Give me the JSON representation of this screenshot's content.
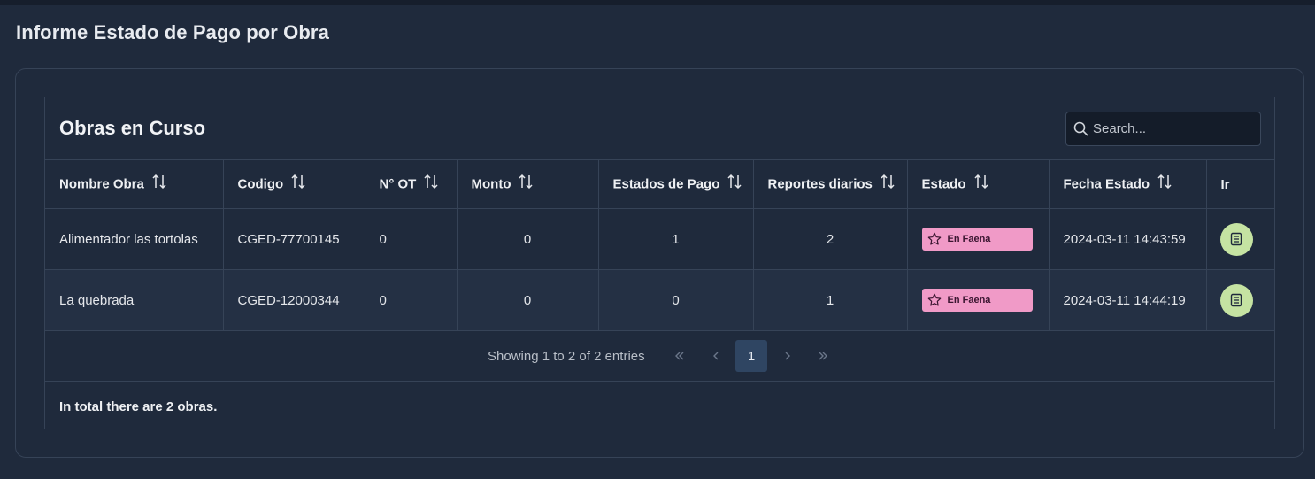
{
  "page": {
    "title": "Informe Estado de Pago por Obra"
  },
  "card": {
    "title": "Obras en Curso",
    "search_placeholder": "Search..."
  },
  "table": {
    "columns": [
      "Nombre Obra",
      "Codigo",
      "N° OT",
      "Monto",
      "Estados de Pago",
      "Reportes diarios",
      "Estado",
      "Fecha Estado",
      "Ir"
    ],
    "rows": [
      {
        "nombre": "Alimentador las tortolas",
        "codigo": "CGED-77700145",
        "ot": "0",
        "monto": "0",
        "estados_pago": "1",
        "reportes": "2",
        "estado": "En Faena",
        "fecha": "2024-03-11 14:43:59"
      },
      {
        "nombre": "La quebrada",
        "codigo": "CGED-12000344",
        "ot": "0",
        "monto": "0",
        "estados_pago": "0",
        "reportes": "1",
        "estado": "En Faena",
        "fecha": "2024-03-11 14:44:19"
      }
    ]
  },
  "paginator": {
    "report": "Showing 1 to 2 of 2 entries",
    "current_page": "1",
    "first_icon": "double-chevron-left-icon",
    "prev_icon": "chevron-left-icon",
    "next_icon": "chevron-right-icon",
    "last_icon": "double-chevron-right-icon"
  },
  "footer": {
    "text": "In total there are 2 obras."
  },
  "colors": {
    "background": "#1f2a3c",
    "border": "#364357",
    "badge": "#f09ac7",
    "action_button": "#c5e3a2",
    "active_page": "#2f4562"
  }
}
